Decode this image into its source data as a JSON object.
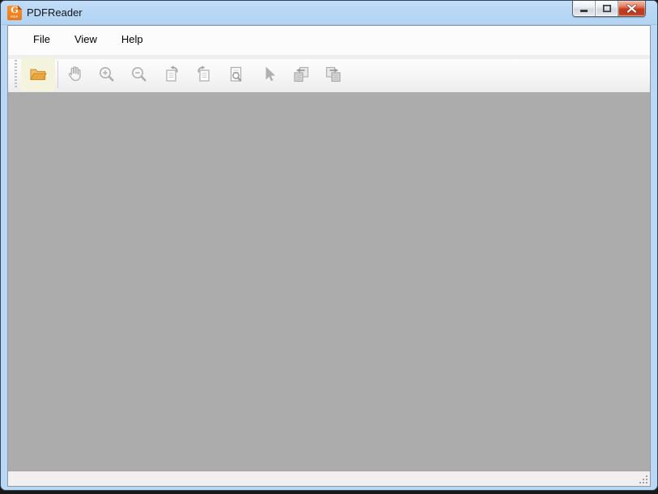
{
  "window": {
    "title": "PDFReader",
    "app_icon": {
      "letter": "G",
      "sub_label": "PDF",
      "color": "#f1801f"
    },
    "controls": [
      {
        "name": "minimize",
        "icon": "minimize-icon"
      },
      {
        "name": "maximize",
        "icon": "maximize-icon"
      },
      {
        "name": "close",
        "icon": "close-icon"
      }
    ]
  },
  "menu_bar": {
    "items": [
      {
        "label": "File"
      },
      {
        "label": "View"
      },
      {
        "label": "Help"
      }
    ]
  },
  "toolbar": {
    "buttons": [
      {
        "name": "open",
        "icon": "open-folder-icon",
        "enabled": true,
        "highlighted": true
      },
      {
        "name": "pan",
        "icon": "hand-icon",
        "enabled": false
      },
      {
        "name": "zoom-in",
        "icon": "zoom-in-icon",
        "enabled": false
      },
      {
        "name": "zoom-out",
        "icon": "zoom-out-icon",
        "enabled": false
      },
      {
        "name": "rotate-page-left",
        "icon": "rotate-page-left-icon",
        "enabled": false
      },
      {
        "name": "rotate-page-right",
        "icon": "rotate-page-right-icon",
        "enabled": false
      },
      {
        "name": "find-in-document",
        "icon": "search-document-icon",
        "enabled": false
      },
      {
        "name": "select",
        "icon": "cursor-arrow-icon",
        "enabled": false
      },
      {
        "name": "previous-page",
        "icon": "page-previous-icon",
        "enabled": false
      },
      {
        "name": "next-page",
        "icon": "page-next-icon",
        "enabled": false
      }
    ]
  },
  "content": {
    "state": "empty"
  },
  "status_bar": {
    "text": ""
  },
  "colors": {
    "titlebar": "#b9d8f6",
    "close_button": "#c63d21",
    "toolbar_highlight": "#f4f3de",
    "folder_icon": "#e9a63c",
    "disabled_icon": "#b0b0b0",
    "content_background": "#acacac"
  }
}
